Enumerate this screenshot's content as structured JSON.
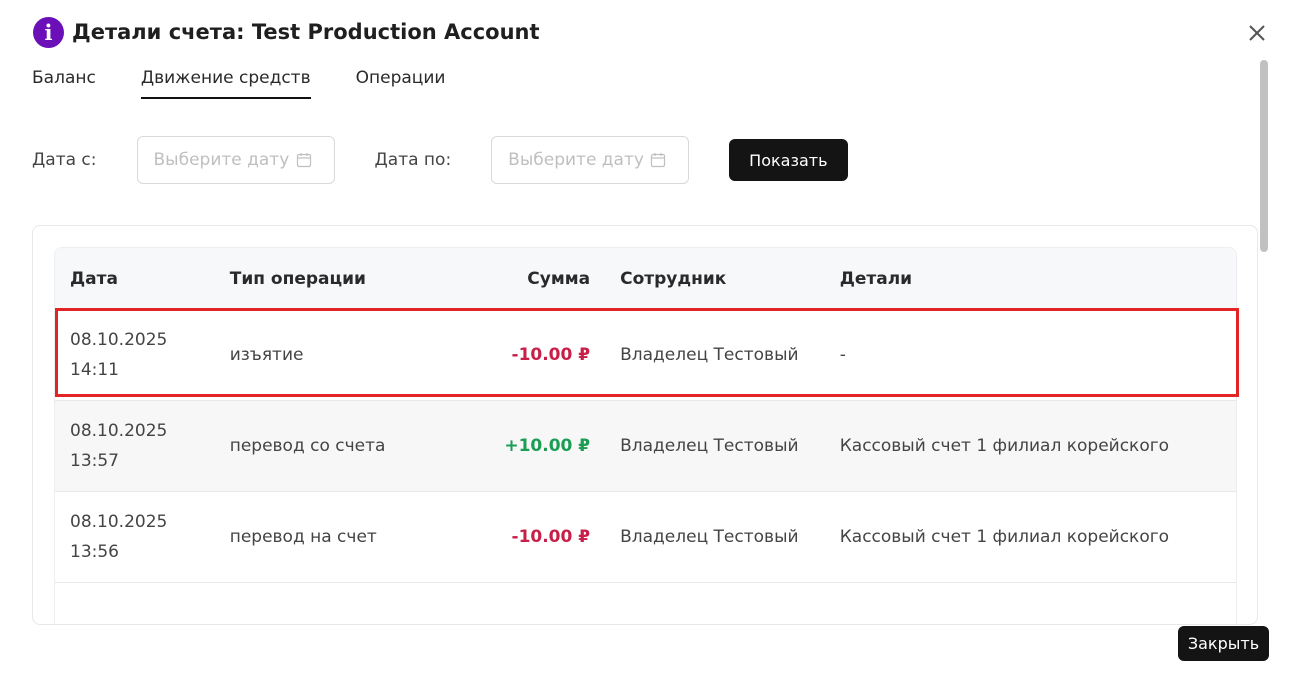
{
  "modal": {
    "title": "Детали счета: Test Production Account",
    "info_glyph": "i",
    "close_icon": "close-icon"
  },
  "tabs": [
    {
      "label": "Баланс",
      "active": false
    },
    {
      "label": "Движение средств",
      "active": true
    },
    {
      "label": "Операции",
      "active": false
    }
  ],
  "filters": {
    "from_label": "Дата с:",
    "from_placeholder": "Выберите дату",
    "from_value": "",
    "to_label": "Дата по:",
    "to_placeholder": "Выберите дату",
    "to_value": "",
    "show_button": "Показать"
  },
  "table": {
    "headers": [
      "Дата",
      "Тип операции",
      "Сумма",
      "Сотрудник",
      "Детали"
    ],
    "rows": [
      {
        "date": "08.10.2025",
        "time": "14:11",
        "type": "изъятие",
        "amount": "-10.00 ₽",
        "sign": "neg",
        "employee": "Владелец Тестовый",
        "details": "-"
      },
      {
        "date": "08.10.2025",
        "time": "13:57",
        "type": "перевод со счета",
        "amount": "+10.00 ₽",
        "sign": "pos",
        "employee": "Владелец Тестовый",
        "details": "Кассовый счет 1 филиал корейского"
      },
      {
        "date": "08.10.2025",
        "time": "13:56",
        "type": "перевод на счет",
        "amount": "-10.00 ₽",
        "sign": "neg",
        "employee": "Владелец Тестовый",
        "details": "Кассовый счет 1 филиал корейского"
      },
      {
        "date": "",
        "time": "",
        "type": "",
        "amount": "",
        "sign": "neg",
        "employee": "",
        "details": ""
      }
    ]
  },
  "colors": {
    "accent": "#6b0fb8",
    "negative": "#c71f48",
    "positive": "#1b9d53",
    "highlight": "#e22424",
    "button": "#141414"
  },
  "footer": {
    "close_button": "Закрыть"
  }
}
